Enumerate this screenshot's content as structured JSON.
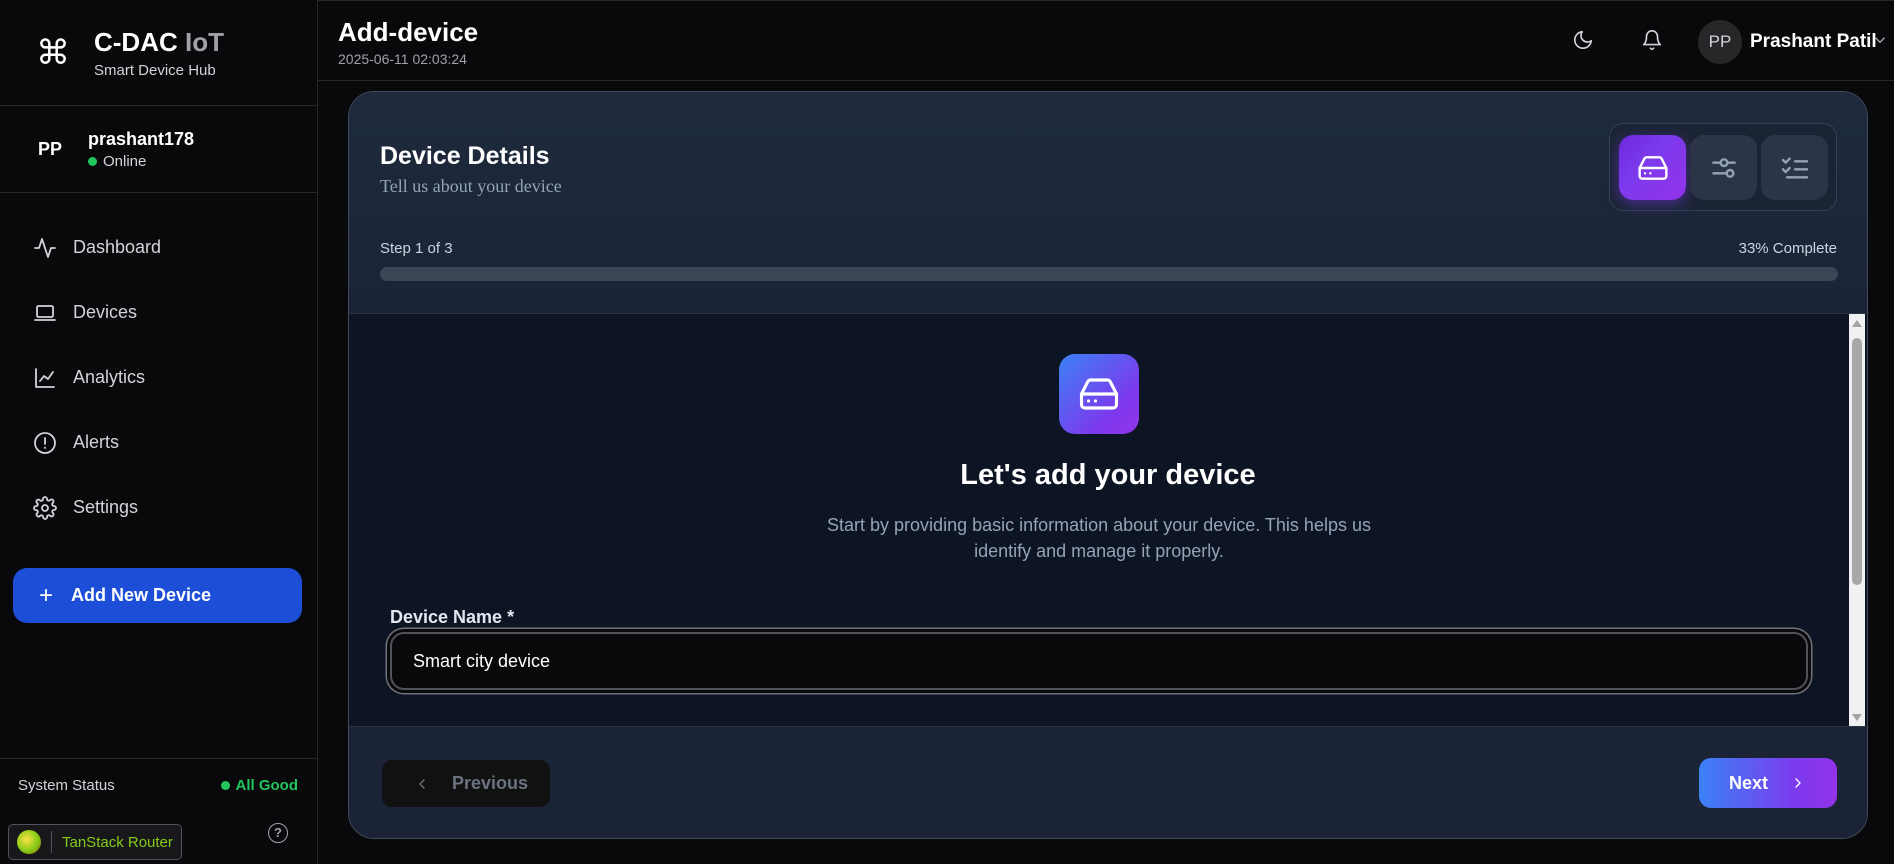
{
  "brand": {
    "title": "C-DAC",
    "title_accent": "IoT",
    "subtitle": "Smart Device Hub",
    "icon": "command-icon"
  },
  "user": {
    "initials": "PP",
    "username": "prashant178",
    "status": "Online"
  },
  "nav": [
    {
      "label": "Dashboard",
      "icon": "activity-icon"
    },
    {
      "label": "Devices",
      "icon": "laptop-icon"
    },
    {
      "label": "Analytics",
      "icon": "chart-line-icon"
    },
    {
      "label": "Alerts",
      "icon": "alert-circle-icon"
    },
    {
      "label": "Settings",
      "icon": "gear-icon"
    }
  ],
  "add_device_button": {
    "plus": "+",
    "label": "Add New Device"
  },
  "system_status": {
    "label": "System Status",
    "value": "All Good",
    "value_color": "#22c55e"
  },
  "router_badge": {
    "label": "TanStack Router"
  },
  "help": {
    "glyph": "?"
  },
  "header": {
    "title": "Add-device",
    "timestamp": "2025-06-11 02:03:24",
    "avatar_initials": "PP",
    "user_name": "Prashant Patil"
  },
  "wizard": {
    "title": "Device Details",
    "subtitle": "Tell us about your device",
    "step_text": "Step 1 of 3",
    "progress_text": "33% Complete",
    "progress_fraction": 0.33,
    "steps": [
      {
        "icon": "hard-drive-icon",
        "active": true
      },
      {
        "icon": "sliders-icon",
        "active": false
      },
      {
        "icon": "list-checks-icon",
        "active": false
      }
    ],
    "hero_title": "Let's add your device",
    "hero_desc": "Start by providing basic information about your device. This helps us identify and manage it properly.",
    "field_label": "Device Name *",
    "field_value": "Smart city device",
    "prev_label": "Previous",
    "next_label": "Next"
  },
  "colors": {
    "accent_blue": "#1d4ed8",
    "accent_purple": "#7c3aed",
    "status_green": "#22c55e"
  }
}
